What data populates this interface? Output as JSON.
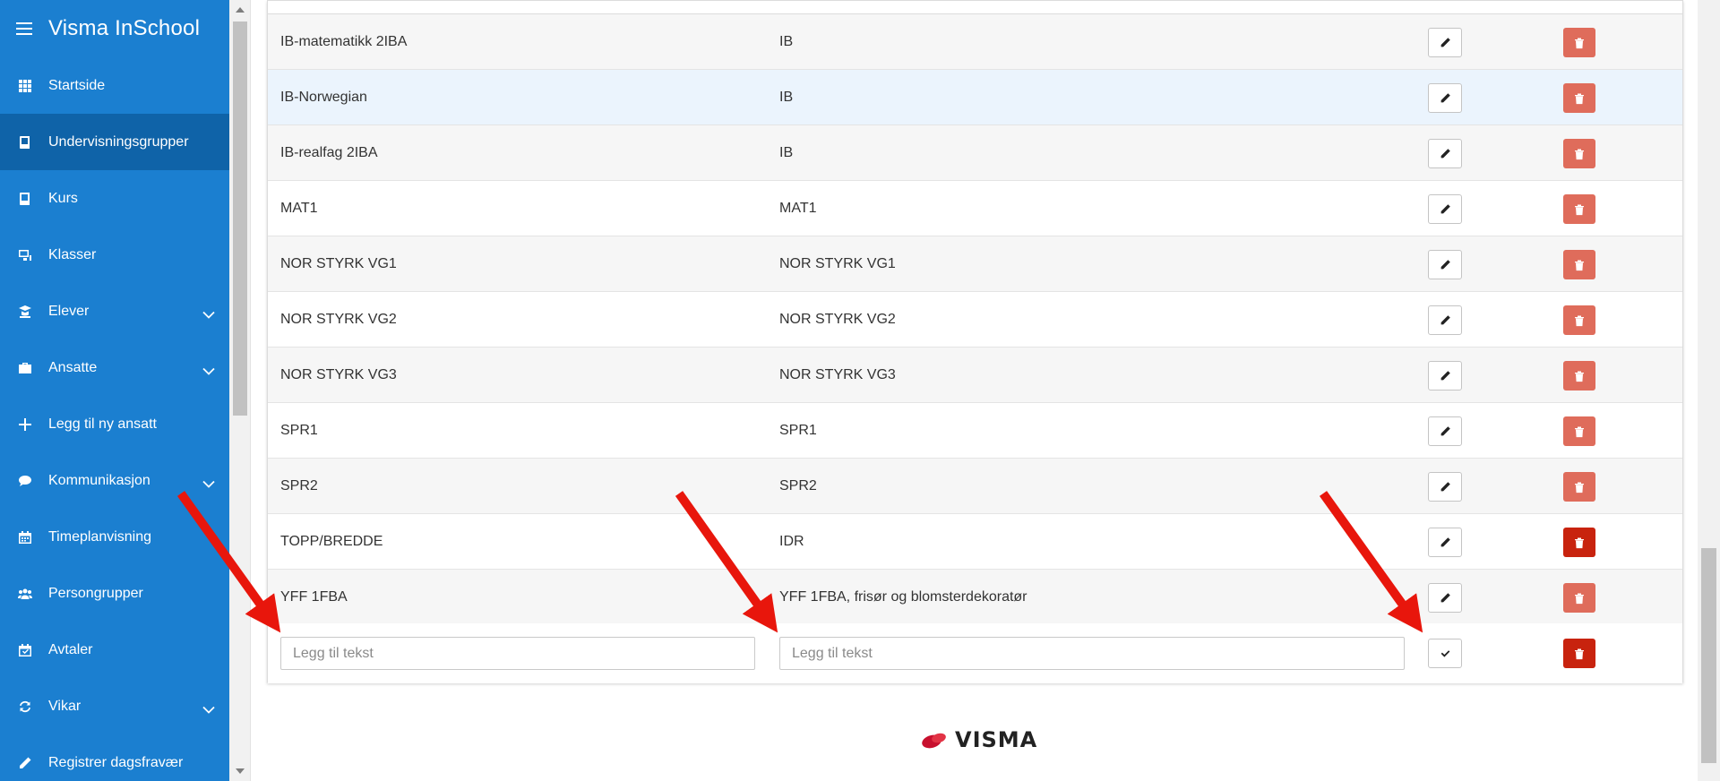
{
  "app": {
    "title": "Visma InSchool"
  },
  "sidebar": {
    "items": [
      {
        "label": "Startside",
        "icon": "grid-icon",
        "expandable": false,
        "active": false
      },
      {
        "label": "Undervisningsgrupper",
        "icon": "book-icon",
        "expandable": false,
        "active": true
      },
      {
        "label": "Kurs",
        "icon": "book-icon",
        "expandable": false,
        "active": false
      },
      {
        "label": "Klasser",
        "icon": "presentation-icon",
        "expandable": false,
        "active": false
      },
      {
        "label": "Elever",
        "icon": "student-icon",
        "expandable": true,
        "active": false
      },
      {
        "label": "Ansatte",
        "icon": "briefcase-icon",
        "expandable": true,
        "active": false
      },
      {
        "label": "Legg til ny ansatt",
        "icon": "plus-icon",
        "expandable": false,
        "active": false
      },
      {
        "label": "Kommunikasjon",
        "icon": "chat-bubble-icon",
        "expandable": true,
        "active": false
      },
      {
        "label": "Timeplanvisning",
        "icon": "calendar-icon",
        "expandable": false,
        "active": false
      },
      {
        "label": "Persongrupper",
        "icon": "people-icon",
        "expandable": false,
        "active": false
      },
      {
        "label": "Avtaler",
        "icon": "calendar-check-icon",
        "expandable": false,
        "active": false
      },
      {
        "label": "Vikar",
        "icon": "refresh-icon",
        "expandable": true,
        "active": false
      },
      {
        "label": "Registrer dagsfravær",
        "icon": "pencil-icon",
        "expandable": false,
        "active": false
      }
    ]
  },
  "table": {
    "rows": [
      {
        "name": "IB-matematikk 2IBA",
        "course": "IB"
      },
      {
        "name": "IB-Norwegian",
        "course": "IB"
      },
      {
        "name": "IB-realfag 2IBA",
        "course": "IB"
      },
      {
        "name": "MAT1",
        "course": "MAT1"
      },
      {
        "name": "NOR STYRK VG1",
        "course": "NOR STYRK VG1"
      },
      {
        "name": "NOR STYRK VG2",
        "course": "NOR STYRK VG2"
      },
      {
        "name": "NOR STYRK VG3",
        "course": "NOR STYRK VG3"
      },
      {
        "name": "SPR1",
        "course": "SPR1"
      },
      {
        "name": "SPR2",
        "course": "SPR2"
      },
      {
        "name": "TOPP/BREDDE",
        "course": "IDR"
      },
      {
        "name": "YFF 1FBA",
        "course": "YFF 1FBA, frisør og blomsterdekoratør"
      }
    ],
    "new_row": {
      "name_placeholder": "Legg til tekst",
      "course_placeholder": "Legg til tekst",
      "name_value": "",
      "course_value": ""
    }
  },
  "footer": {
    "logo_text": "VISMA"
  },
  "colors": {
    "sidebar_bg": "#1b7fd0",
    "sidebar_active": "#0f63a8",
    "delete_light": "#df6c5b",
    "delete_strong": "#c8230e",
    "annotation_arrow": "#e8160c",
    "hover_row": "#ebf4fd"
  }
}
